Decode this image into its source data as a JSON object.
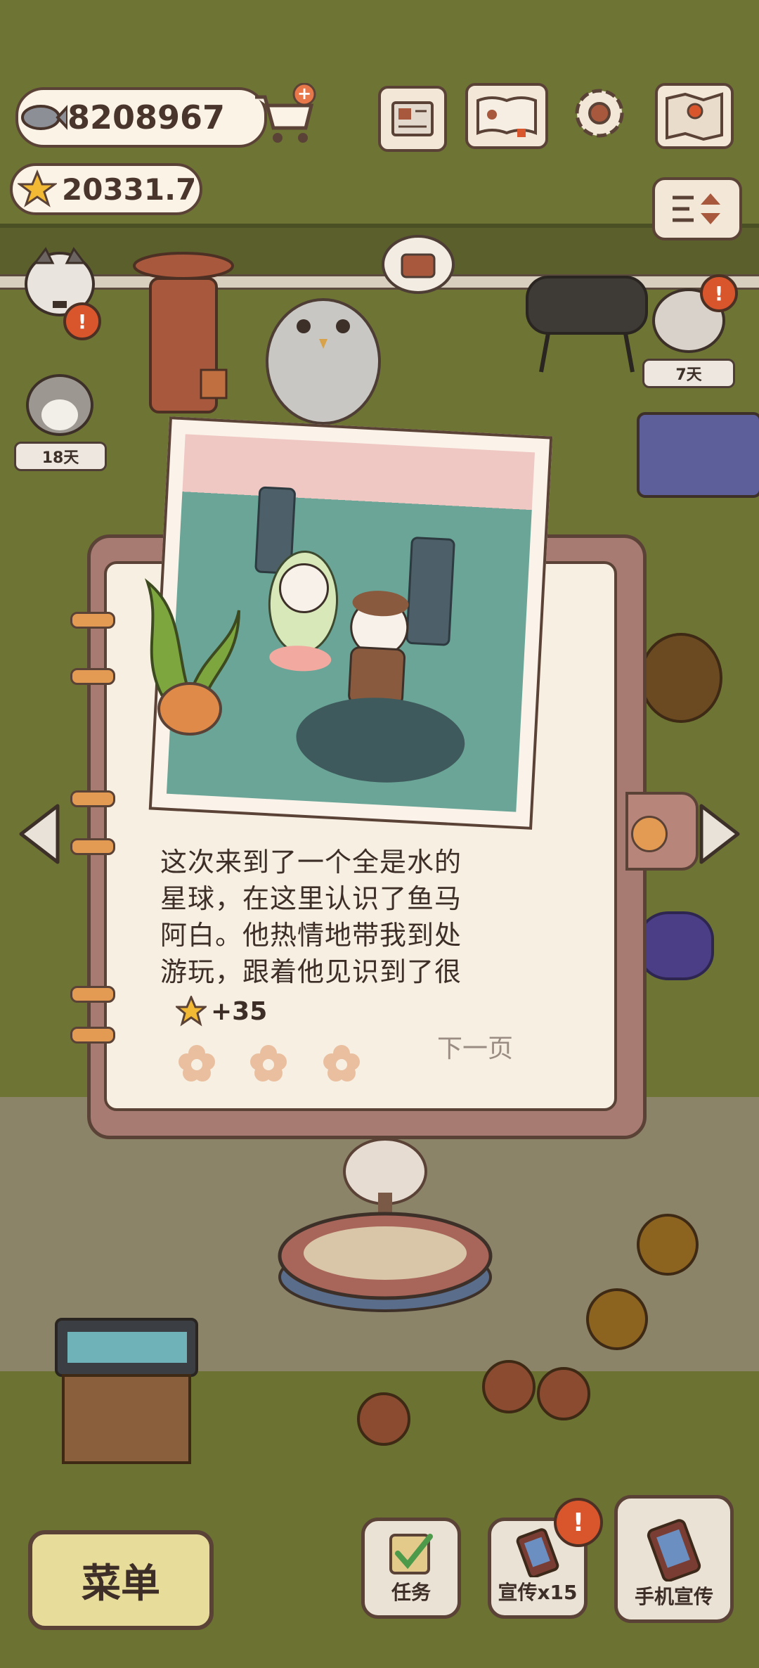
{
  "currency": {
    "fish_amount": "8208967",
    "star_amount": "20331.7"
  },
  "top_buttons": [
    "newspaper-icon",
    "paw-book-icon",
    "gear-icon",
    "map-icon"
  ],
  "cats": {
    "left_day_tag": "18天",
    "right_day_tag": "7天"
  },
  "story": {
    "text_lines": [
      "这次来到了一个全是水的",
      "星球，在这里认识了鱼马",
      "阿白。他热情地带我到处",
      "游玩，跟着他见识到了很"
    ],
    "reward": "+35",
    "next_page": "下一页"
  },
  "bottom": {
    "menu_label": "菜单",
    "task_label": "任务",
    "promo_label": "宣传x15",
    "phone_promo_label": "手机宣传"
  },
  "colors": {
    "outline": "#5b4236",
    "paper": "#f7f0e2",
    "accent_orange": "#e39a52",
    "alert_red": "#d9562d"
  }
}
